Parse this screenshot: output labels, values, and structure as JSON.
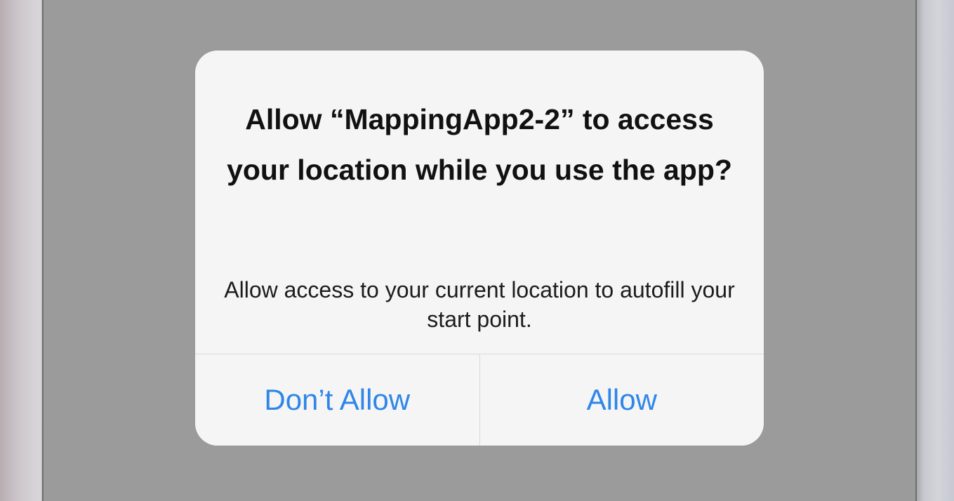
{
  "alert": {
    "title": "Allow “MappingApp2-2” to access your location while you use the app?",
    "message": "Allow access to your current location to autofill your start point.",
    "buttons": {
      "dont_allow_label": "Don’t Allow",
      "allow_label": "Allow"
    }
  },
  "colors": {
    "accent": "#2f86e8",
    "dimmed_background": "#9b9b9b",
    "alert_background": "#f5f5f5"
  }
}
